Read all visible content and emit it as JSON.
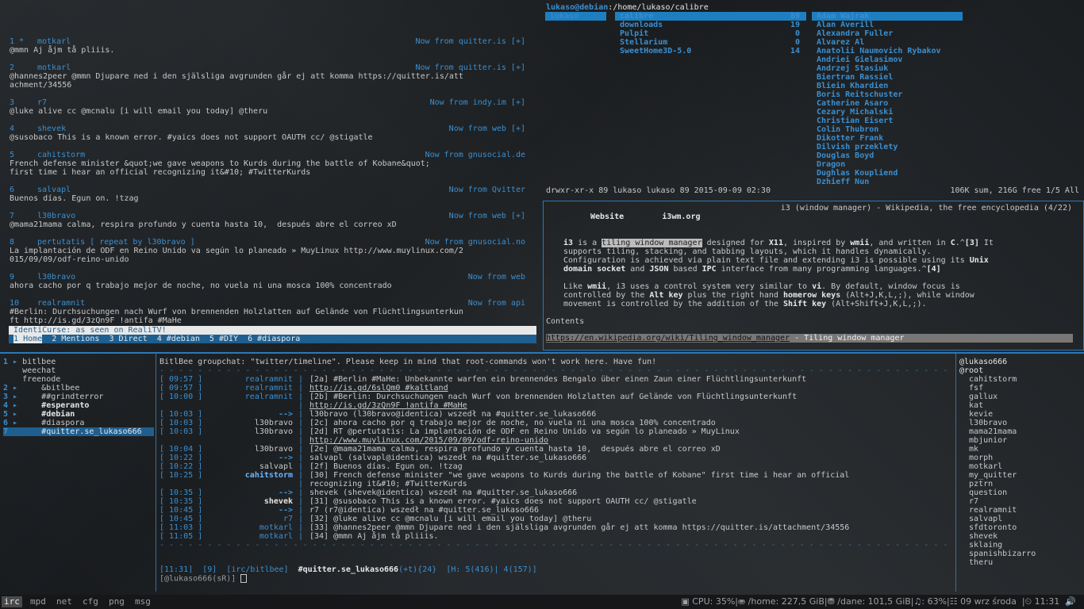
{
  "quitter": {
    "tweets": [
      {
        "num": "1 *",
        "nick": "motkarl",
        "source": "Now from quitter.is [+]",
        "lines": [
          "@mmn Aj åjm tå pliiis."
        ]
      },
      {
        "num": "2",
        "nick": "motkarl",
        "source": "Now from quitter.is [+]",
        "lines": [
          "@hannes2peer @mmn Djupare ned i den själsliga avgrunden går ej att komma https://quitter.is/att",
          "achment/34556"
        ]
      },
      {
        "num": "3",
        "nick": "r7",
        "source": "Now from indy.im [+]",
        "lines": [
          "@luke alive cc @mcnalu [i will email you today] @theru"
        ]
      },
      {
        "num": "4",
        "nick": "shevek",
        "source": "Now from web [+]",
        "lines": [
          "@susobaco This is a known error. #yaics does not support OAUTH cc/ @stigatle"
        ]
      },
      {
        "num": "5",
        "nick": "cahitstorm",
        "source": "Now from gnusocial.de",
        "lines": [
          "French defense minister &quot;we gave weapons to Kurds during the battle of Kobane&quot;",
          "first time i hear an official recognizing it&#10; #TwitterKurds"
        ]
      },
      {
        "num": "6",
        "nick": "salvapl",
        "source": "Now from Qvitter",
        "lines": [
          "Buenos días. Egun on. !tzag"
        ]
      },
      {
        "num": "7",
        "nick": "l30bravo",
        "source": "Now from web [+]",
        "lines": [
          "@mama21mama calma, respira profundo y cuenta hasta 10,  después abre el correo xD"
        ]
      },
      {
        "num": "8",
        "nick": "pertutatis [ repeat by l30bravo ]",
        "source": "Now from gnusocial.no",
        "lines": [
          "La implantación de ODF en Reino Unido va según lo planeado » MuyLinux http://www.muylinux.com/2",
          "015/09/09/odf-reino-unido"
        ]
      },
      {
        "num": "9",
        "nick": "l30bravo",
        "source": "Now from web",
        "lines": [
          "ahora cacho por q trabajo mejor de noche, no vuela ni una mosca 100% concentrado"
        ]
      },
      {
        "num": "10",
        "nick": "realramnit",
        "source": "Now from api",
        "lines": [
          "#Berlin: Durchsuchungen nach Wurf von brennenden Holzlatten auf Gelände von Flüchtlingsunterkun",
          "ft http://is.gd/3zQn9F !antifa #MaHe"
        ]
      }
    ],
    "status_title": "IdentiCurse: as seen on RealiTV!",
    "tabs": [
      "1 Home",
      "2 Mentions",
      "3 Direct",
      "4 #debian",
      "5 #DIY",
      "6 #diaspora"
    ]
  },
  "ranger": {
    "host": "lukaso@debian",
    "path": ":/home/lukaso/",
    "current": "calibre",
    "col1": [
      "lukaso"
    ],
    "col2": [
      {
        "name": "calibre",
        "count": "89"
      },
      {
        "name": "downloads",
        "count": "19"
      },
      {
        "name": "Pulpit",
        "count": "0"
      },
      {
        "name": "Stellarium",
        "count": "0"
      },
      {
        "name": "SweetHome3D-5.0",
        "count": "14"
      }
    ],
    "col3": [
      "Adam Wajrak",
      "Alan Averill",
      "Alexandra Fuller",
      "Alvarez Al",
      "Anatolii Naumovich Rybakov",
      "Andriei Gielasimov",
      "Andrzej Stasiuk",
      "Biertran Rassiel",
      "Bliein Khardien",
      "Boris Reitschuster",
      "Catherine Asaro",
      "Cezary Michalski",
      "Christian Eisert",
      "Colin Thubron",
      "Dikotter Frank",
      "Dilvish przeklety",
      "Douglas Boyd",
      "Dragon",
      "Dughlas Koupliend",
      "Dzhieff Nun"
    ],
    "footer_left": "drwxr-xr-x 89 lukaso lukaso 89 2015-09-09 02:30",
    "footer_right": "106K sum, 216G free  1/5  All"
  },
  "w3m": {
    "title": "i3 (window manager) - Wikipedia, the free encyclopedia (4/22)",
    "website_label": "Website",
    "website_value": "i3wm.org",
    "p1": [
      [
        "",
        "i3",
        " is a ",
        "tiling window manager",
        " designed for ",
        "X11",
        ", inspired by ",
        "wmii",
        ", and written in ",
        "C",
        ".^",
        "[3]",
        " It"
      ],
      [
        "supports tiling, stacking, and tabbing layouts, which it handles dynamically."
      ],
      [
        "Configuration is achieved via plain text file and extending i3 is possible using its ",
        "Unix"
      ],
      [
        "domain socket",
        " and ",
        "JSON",
        " based ",
        "IPC",
        " interface from many programming languages.^",
        "[4]"
      ]
    ],
    "p2": [
      "Like |wmii|, i3 uses a control system very similar to |vi|. By default, window focus is",
      "controlled by the |Alt key| plus the right hand |homerow keys| (Alt+J,K,L,;), while window",
      "movement is controlled by the addition of the |Shift key| (Alt+Shift+J,K,L,;)."
    ],
    "contents": "Contents",
    "url": "https://en.wikipedia.org/wiki/Tiling_window_manager",
    "url_title": " - Tiling window manager"
  },
  "weechat": {
    "buffers": [
      {
        "n": "1",
        "arrow": "▸",
        "name": "bitlbee",
        "indent": 0
      },
      {
        "n": "",
        "arrow": "",
        "name": "weechat",
        "indent": 0
      },
      {
        "n": "",
        "arrow": "",
        "name": "freenode",
        "indent": 0
      },
      {
        "n": "2",
        "arrow": "▸",
        "name": "&bitlbee",
        "indent": 1
      },
      {
        "n": "3",
        "arrow": "▸",
        "name": "##grindterror",
        "indent": 1
      },
      {
        "n": "4",
        "arrow": "▸",
        "name": "#esperanto",
        "indent": 1
      },
      {
        "n": "5",
        "arrow": "▸",
        "name": "#debian",
        "indent": 1
      },
      {
        "n": "6",
        "arrow": "▸",
        "name": "#diaspora",
        "indent": 1
      },
      {
        "n": "7",
        "arrow": "",
        "name": "#quitter.se_lukaso666",
        "indent": 1
      }
    ],
    "topic": "BitlBee groupchat: \"twitter/timeline\". Please keep in mind that root-commands won't work here. Have fun!",
    "lines": [
      {
        "ts": "[ 09:57 ]",
        "prefix": "realramnit",
        "msg": "[2a] #Berlin #MaHe: Unbekannte warfen ein brennendes Bengalo über einen Zaun einer Flüchtlingsunterkunft"
      },
      {
        "ts": "[ 09:57 ]",
        "prefix": "realramnit",
        "msg": "http://is.gd/6slQm0 #kaltland"
      },
      {
        "ts": "[ 10:00 ]",
        "prefix": "realramnit",
        "msg": "[2b] #Berlin: Durchsuchungen nach Wurf von brennenden Holzlatten auf Gelände von Flüchtlingsunterkunft"
      },
      {
        "ts": "",
        "prefix": "",
        "msg": "http://is.gd/3zQn9F !antifa #MaHe"
      },
      {
        "ts": "[ 10:03 ]",
        "prefix": "-->",
        "msg": "l30bravo (l30bravo@identica) wszedł na #quitter.se_lukaso666"
      },
      {
        "ts": "[ 10:03 ]",
        "prefix": "l30bravo",
        "msg": "[2c] ahora cacho por q trabajo mejor de noche, no vuela ni una mosca 100% concentrado"
      },
      {
        "ts": "[ 10:03 ]",
        "prefix": "l30bravo",
        "msg": "[2d] RT @pertutatis: La implantación de ODF en Reino Unido va según lo planeado » MuyLinux"
      },
      {
        "ts": "",
        "prefix": "",
        "msg": "http://www.muylinux.com/2015/09/09/odf-reino-unido"
      },
      {
        "ts": "[ 10:04 ]",
        "prefix": "l30bravo",
        "msg": "[2e] @mama21mama calma, respira profundo y cuenta hasta 10,  después abre el correo xD"
      },
      {
        "ts": "[ 10:22 ]",
        "prefix": "-->",
        "msg": "salvapl (salvapl@identica) wszedł na #quitter.se_lukaso666"
      },
      {
        "ts": "[ 10:22 ]",
        "prefix": "salvapl",
        "msg": "[2f] Buenos días. Egun on. !tzag"
      },
      {
        "ts": "[ 10:25 ]",
        "prefix": "cahitstorm",
        "msg": "[30] French defense minister \"we gave weapons to Kurds during the battle of Kobane\" first time i hear an official"
      },
      {
        "ts": "",
        "prefix": "",
        "msg": "recognizing it&#10; #TwitterKurds"
      },
      {
        "ts": "[ 10:35 ]",
        "prefix": "-->",
        "msg": "shevek (shevek@identica) wszedł na #quitter.se_lukaso666"
      },
      {
        "ts": "[ 10:35 ]",
        "prefix": "shevek",
        "msg": "[31] @susobaco This is a known error. #yaics does not support OAUTH cc/ @stigatle"
      },
      {
        "ts": "[ 10:45 ]",
        "prefix": "-->",
        "msg": "r7 (r7@identica) wszedł na #quitter.se_lukaso666"
      },
      {
        "ts": "[ 10:45 ]",
        "prefix": "r7",
        "msg": "[32] @luke alive cc @mcnalu [i will email you today] @theru"
      },
      {
        "ts": "[ 11:03 ]",
        "prefix": "motkarl",
        "msg": "[33] @hannes2peer @mmn Djupare ned i den själsliga avgrunden går ej att komma https://quitter.is/attachment/34556"
      },
      {
        "ts": "[ 11:05 ]",
        "prefix": "motkarl",
        "msg": "[34] @mmn Aj åjm tå pliiis."
      }
    ],
    "nicks": [
      "@lukaso666",
      "@root",
      "cahitstorm",
      "fsf",
      "gallux",
      "kat",
      "kevie",
      "l30bravo",
      "mama21mama",
      "mbjunior",
      "mk",
      "morph",
      "motkarl",
      "my_quitter",
      "pztrn",
      "question",
      "r7",
      "realramnit",
      "salvapl",
      "sfdtoronto",
      "shevek",
      "sklaing",
      "spanishbizarro",
      "theru"
    ],
    "status": {
      "time": "[11:31]",
      "num": "[9]",
      "server": "[irc/bitlbee]",
      "channel": "#quitter.se_lukaso666",
      "mode": "(+t)",
      "count": "{24}",
      "hot": "[H: 5(416)| 4(157)]"
    },
    "prompt": "[@lukaso666(sR)]"
  },
  "bar": {
    "workspaces": [
      "irc",
      "mpd",
      "net",
      "cfg",
      "png",
      "msg"
    ],
    "active": "irc",
    "system": "▣ CPU: 35%|⛂ /home: 227,5 GiB|⛃ /dane: 101,5 GiB|♫: 63%|☷ 09 wrz środa  |⏲ 11:31  🔊"
  }
}
